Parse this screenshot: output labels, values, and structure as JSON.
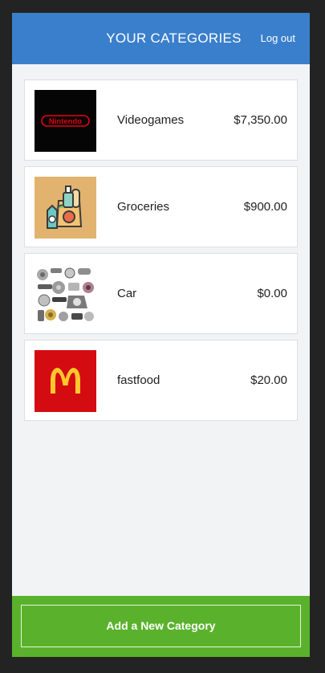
{
  "header": {
    "title": "YOUR CATEGORIES",
    "logout_label": "Log out",
    "color": "#3a7fcc"
  },
  "categories": [
    {
      "name": "Videogames",
      "amount": "$7,350.00",
      "icon": "nintendo-logo",
      "logo_text": "Nintendo"
    },
    {
      "name": "Groceries",
      "amount": "$900.00",
      "icon": "groceries-bag-icon"
    },
    {
      "name": "Car",
      "amount": "$0.00",
      "icon": "car-parts-photo"
    },
    {
      "name": "fastfood",
      "amount": "$20.00",
      "icon": "mcdonalds-logo"
    }
  ],
  "footer": {
    "add_label": "Add a New Category",
    "color": "#5ab22c"
  }
}
